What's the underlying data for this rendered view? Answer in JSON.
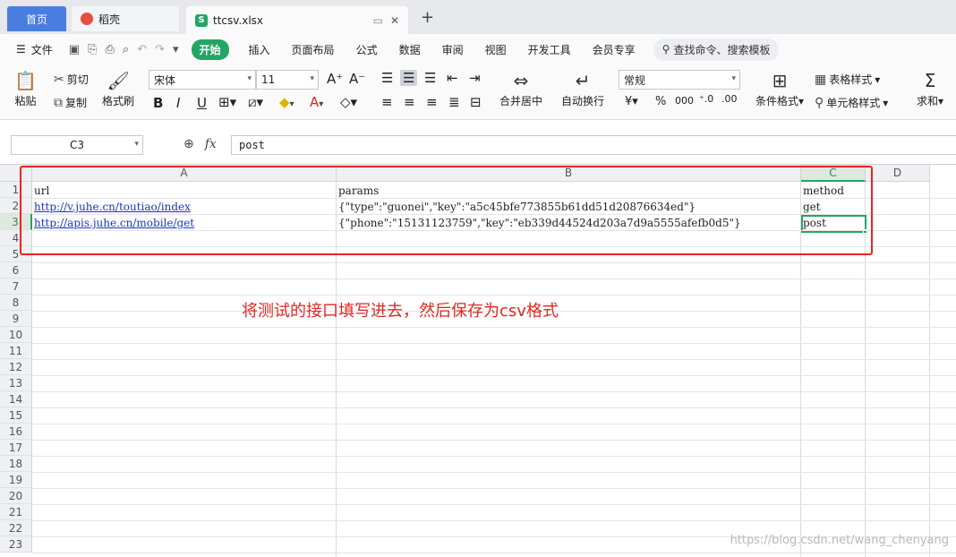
{
  "tabs": [
    {
      "label": "首页",
      "active": false
    },
    {
      "label": "稻壳",
      "active": false
    },
    {
      "label": "ttcsv.xlsx",
      "active": true
    }
  ],
  "menu": {
    "file": "文件",
    "items": [
      "开始",
      "插入",
      "页面布局",
      "公式",
      "数据",
      "审阅",
      "视图",
      "开发工具",
      "会员专享"
    ],
    "search_placeholder": "查找命令、搜索模板"
  },
  "ribbon": {
    "paste": "粘贴",
    "cut": "剪切",
    "copy": "复制",
    "format_painter": "格式刷",
    "font_name": "宋体",
    "font_size": "11",
    "merge_center": "合并居中",
    "wrap_text": "自动换行",
    "number_format": "常规",
    "conditional_format": "条件格式",
    "table_style": "表格样式",
    "cell_style": "单元格样式",
    "sum": "求和",
    "currency_symbol": "¥",
    "percent_symbol": "%",
    "thousands_symbol": "000"
  },
  "formula_bar": {
    "name_box": "C3",
    "fx": "fx",
    "value": "post"
  },
  "grid": {
    "columns": [
      "A",
      "B",
      "C",
      "D"
    ],
    "active_column": "C",
    "active_row": "3",
    "rows": [
      "1",
      "2",
      "3",
      "4",
      "5",
      "6",
      "7",
      "8",
      "9",
      "10",
      "11",
      "12",
      "13",
      "14",
      "15",
      "16",
      "17",
      "18",
      "19",
      "20",
      "21",
      "22",
      "23"
    ],
    "cells": {
      "A1": "url",
      "B1": "params",
      "C1": "method",
      "A2": "http://v.juhe.cn/toutiao/index",
      "B2": "{\"type\":\"guonei\",\"key\":\"a5c45bfe773855b61dd51d20876634ed\"}",
      "C2": "get",
      "A3": "http://apis.juhe.cn/mobile/get",
      "B3": "{\"phone\":\"15131123759\",\"key\":\"eb339d44524d203a7d9a5555afefb0d5\"}",
      "C3": "post"
    }
  },
  "annotation": "将测试的接口填写进去，然后保存为csv格式",
  "watermark": "https://blog.csdn.net/wang_chenyang"
}
